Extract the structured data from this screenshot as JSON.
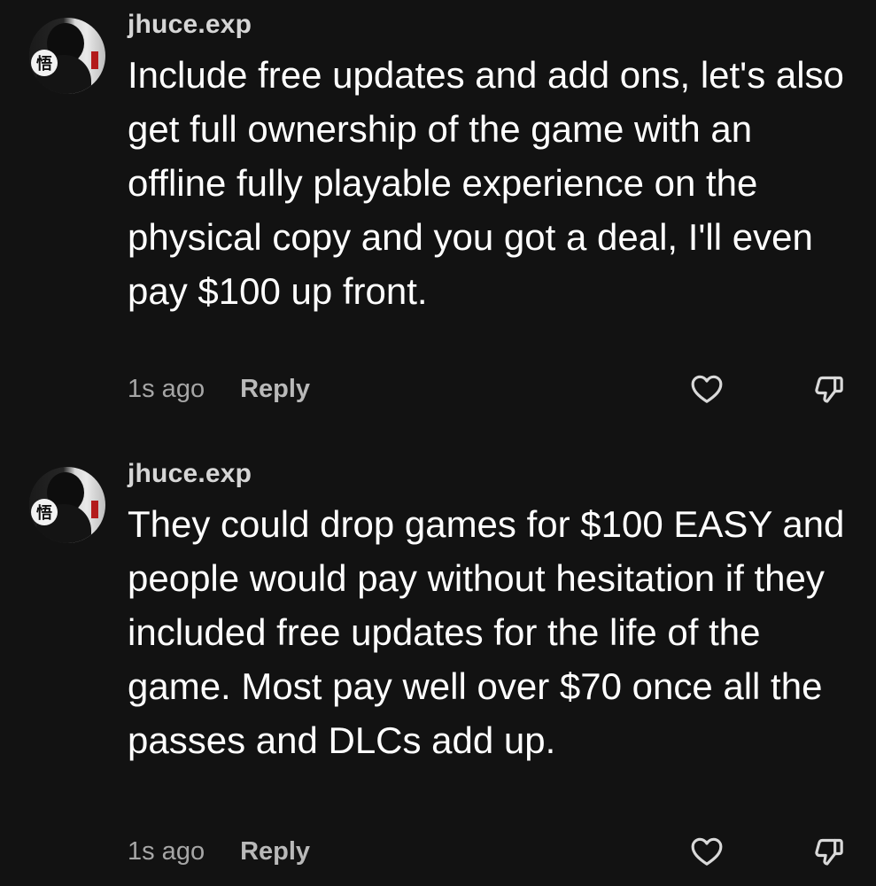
{
  "comments": [
    {
      "username": "jhuce.exp",
      "text": "Include free updates and add ons, let's also get full ownership of the game with an offline fully playable experience on the physical copy and you got a deal, I'll even pay $100 up front.",
      "timestamp": "1s ago",
      "reply_label": "Reply",
      "avatar_badge": "悟",
      "like_icon": "heart-icon",
      "dislike_icon": "thumbs-down-icon"
    },
    {
      "username": "jhuce.exp",
      "text": "They could drop games for $100 EASY and people would pay without hesitation if they included free updates for the life of the game. Most pay well over $70 once all the passes and DLCs add up.",
      "timestamp": "1s ago",
      "reply_label": "Reply",
      "avatar_badge": "悟",
      "like_icon": "heart-icon",
      "dislike_icon": "thumbs-down-icon"
    }
  ],
  "colors": {
    "background": "#121212",
    "text": "#ffffff",
    "muted": "#a6a6a6"
  }
}
